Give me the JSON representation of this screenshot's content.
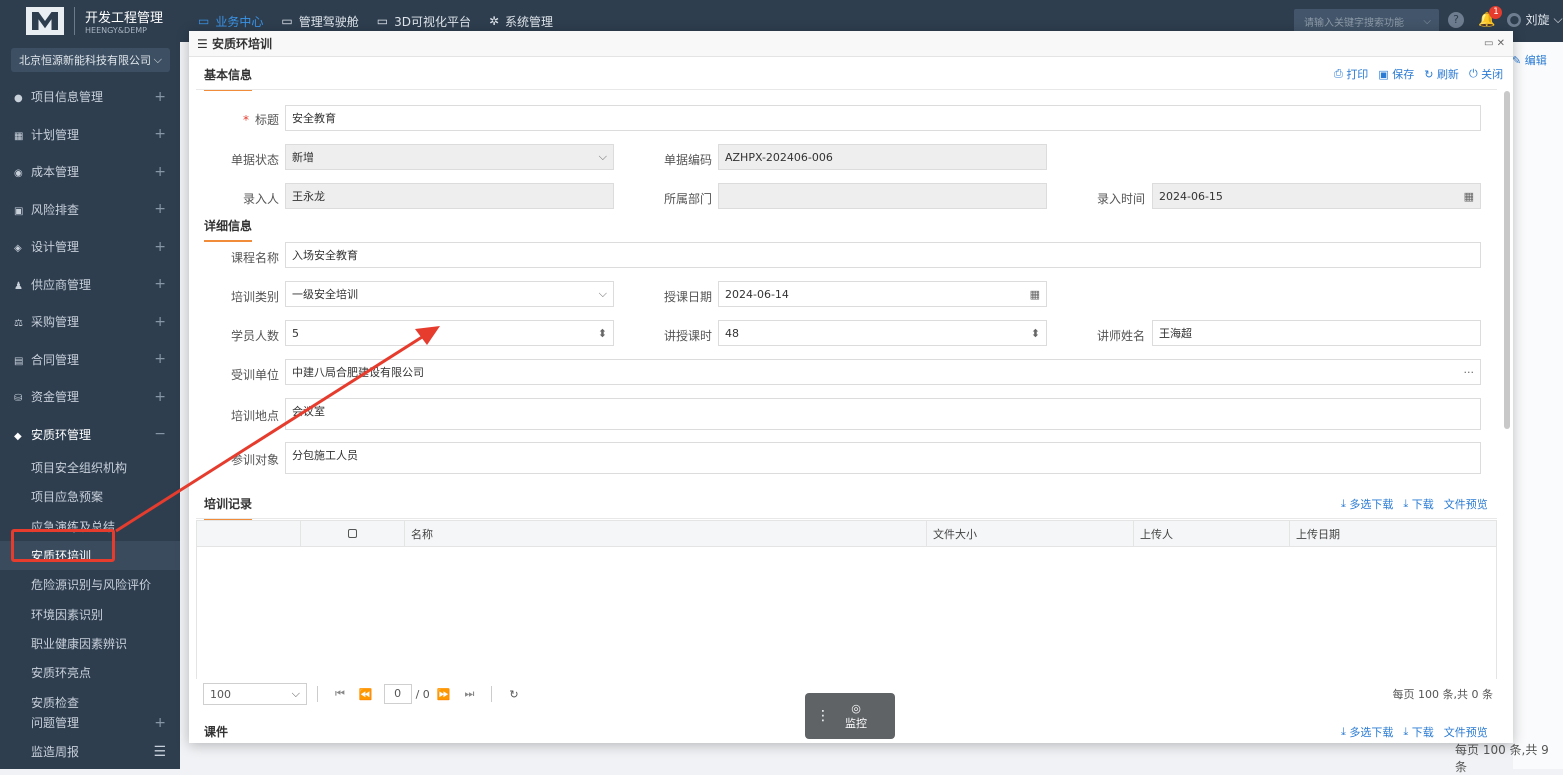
{
  "app": {
    "logo_title": "开发工程管理",
    "logo_subtitle": "HEENGY&DEMP",
    "company": "北京恒源新能科技有限公司"
  },
  "topnav": {
    "items": [
      {
        "label": "业务中心",
        "icon": "layout-icon"
      },
      {
        "label": "管理驾驶舱",
        "icon": "monitor-icon"
      },
      {
        "label": "3D可视化平台",
        "icon": "screen-icon"
      },
      {
        "label": "系统管理",
        "icon": "gear-icon"
      }
    ],
    "search_placeholder": "请输入关键字搜索功能",
    "notification_count": "1",
    "user": "刘旋"
  },
  "sidebar": {
    "items": [
      {
        "label": "项目信息管理",
        "icon": "●"
      },
      {
        "label": "计划管理",
        "icon": "▦"
      },
      {
        "label": "成本管理",
        "icon": "◉"
      },
      {
        "label": "风险排查",
        "icon": "▣"
      },
      {
        "label": "设计管理",
        "icon": "◈"
      },
      {
        "label": "供应商管理",
        "icon": "♟"
      },
      {
        "label": "采购管理",
        "icon": "⚖"
      },
      {
        "label": "合同管理",
        "icon": "▤"
      },
      {
        "label": "资金管理",
        "icon": "⛁"
      },
      {
        "label": "安质环管理",
        "icon": "◆"
      }
    ],
    "submenu": [
      "项目安全组织机构",
      "项目应急预案",
      "应急演练及总结",
      "安质环培训",
      "危险源识别与风险评价",
      "环境因素识别",
      "职业健康因素辨识",
      "安质环亮点",
      "安质检查"
    ],
    "bottom": [
      "问题管理",
      "监造周报"
    ]
  },
  "modal": {
    "title": "安质环培训",
    "toolbar": {
      "print": "打印",
      "save": "保存",
      "refresh": "刷新",
      "close": "关闭"
    },
    "basic_section": "基本信息",
    "detail_section": "详细信息",
    "fields": {
      "title": {
        "label": "标题",
        "value": "安全教育"
      },
      "doc_status": {
        "label": "单据状态",
        "value": "新增"
      },
      "doc_code": {
        "label": "单据编码",
        "value": "AZHPX-202406-006"
      },
      "entry_person": {
        "label": "录入人",
        "value": "王永龙"
      },
      "department": {
        "label": "所属部门",
        "value": ""
      },
      "entry_time": {
        "label": "录入时间",
        "value": "2024-06-15"
      },
      "course_name": {
        "label": "课程名称",
        "value": "入场安全教育"
      },
      "training_type": {
        "label": "培训类别",
        "value": "一级安全培训"
      },
      "teach_date": {
        "label": "授课日期",
        "value": "2024-06-14"
      },
      "students": {
        "label": "学员人数",
        "value": "5"
      },
      "hours": {
        "label": "讲授课时",
        "value": "48"
      },
      "lecturer": {
        "label": "讲师姓名",
        "value": "王海超"
      },
      "trained_unit": {
        "label": "受训单位",
        "value": "中建八局合肥建设有限公司"
      },
      "location": {
        "label": "培训地点",
        "value": "会议室"
      },
      "audience": {
        "label": "参训对象",
        "value": "分包施工人员"
      }
    },
    "records": {
      "section": "培训记录",
      "multi_download": "多选下载",
      "download": "下载",
      "preview": "文件预览",
      "columns": [
        "名称",
        "文件大小",
        "上传人",
        "上传日期"
      ],
      "page_size": "100",
      "page_current": "0",
      "page_total": "/ 0",
      "summary": "每页 100 条,共 0 条"
    },
    "courseware": {
      "section": "课件",
      "multi_download": "多选下载",
      "download": "下载",
      "preview": "文件预览"
    }
  },
  "background": {
    "edit": "编辑",
    "footer": "每页 100 条,共 9 条"
  },
  "monitor_label": "监控"
}
